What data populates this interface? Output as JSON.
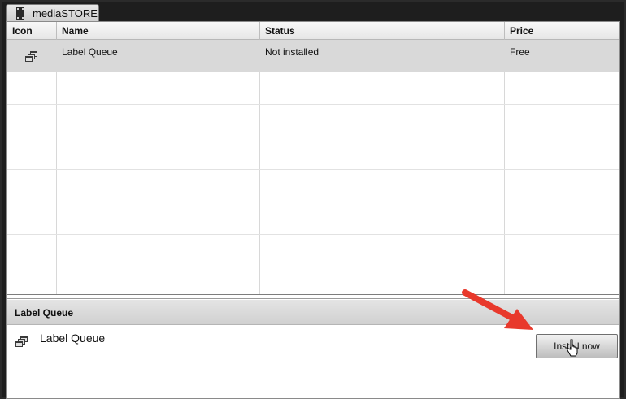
{
  "tab": {
    "label": "mediaSTORE"
  },
  "table": {
    "columns": [
      "Icon",
      "Name",
      "Status",
      "Price"
    ],
    "rows": [
      {
        "name": "Label Queue",
        "status": "Not installed",
        "price": "Free"
      }
    ]
  },
  "detail": {
    "title": "Label Queue",
    "name": "Label Queue",
    "install_label": "Install now"
  },
  "colors": {
    "selected_row": "#d9d9d9",
    "arrow": "#e8392c"
  }
}
